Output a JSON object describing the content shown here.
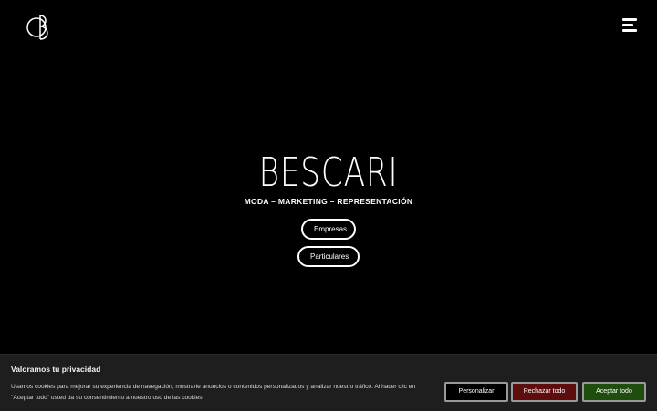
{
  "header": {
    "logo_icon": "bescari-monogram-icon",
    "menu_icon": "hamburger-menu-icon"
  },
  "hero": {
    "brand": "BESCARI",
    "tagline": "MODA – MARKETING – REPRESENTACIÓN",
    "buttons": [
      "Empresas",
      "Particulares"
    ]
  },
  "cookie_banner": {
    "title": "Valoramos tu privacidad",
    "text": "Usamos cookies para mejorar su experiencia de navegación, mostrarle anuncios o contenidos personalizados y analizar nuestro tráfico. Al hacer clic en \"Aceptar todo\" usted da su consentimiento a nuestro uso de las cookies.",
    "customize_label": "Personalizar",
    "reject_label": "Rechazar todo",
    "accept_label": "Aceptar todo",
    "colors": {
      "reject": "#5e0d0d",
      "accept": "#1f4d0e",
      "background": "#1e1e1e"
    }
  }
}
